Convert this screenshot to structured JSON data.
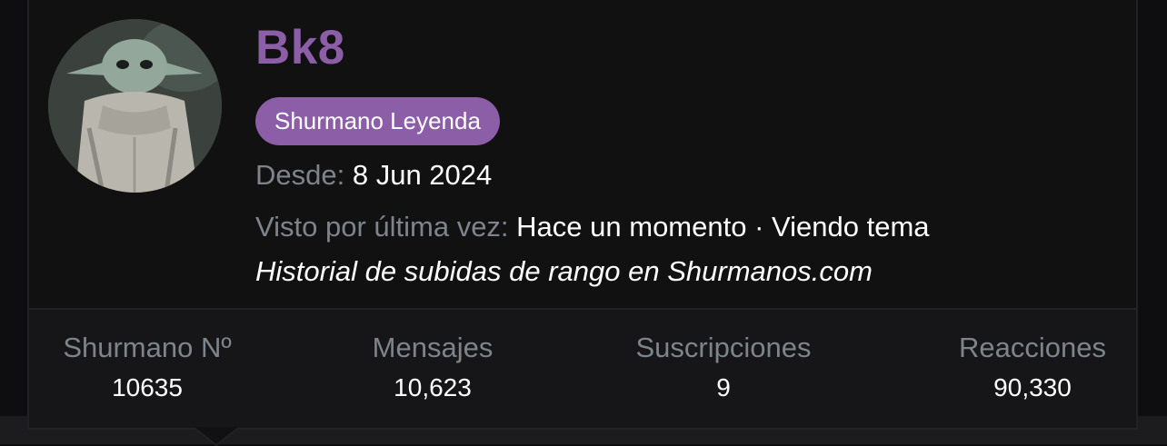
{
  "profile": {
    "username": "Bk8",
    "rank_badge": "Shurmano Leyenda",
    "joined_label": "Desde:",
    "joined_value": "8 Jun 2024",
    "last_seen_label": "Visto por última vez:",
    "last_seen_value": "Hace un momento · Viendo tema",
    "history_link": "Historial de subidas de rango en Shurmanos.com"
  },
  "stats": [
    {
      "label": "Shurmano Nº",
      "value": "10635"
    },
    {
      "label": "Mensajes",
      "value": "10,623"
    },
    {
      "label": "Suscripciones",
      "value": "9"
    },
    {
      "label": "Reacciones",
      "value": "90,330"
    }
  ],
  "colors": {
    "accent": "#8c5ea8",
    "label_gray": "#7e848c",
    "card_bg": "#111112",
    "text": "#ffffff"
  },
  "icons": {
    "avatar": "baby-yoda-avatar"
  }
}
